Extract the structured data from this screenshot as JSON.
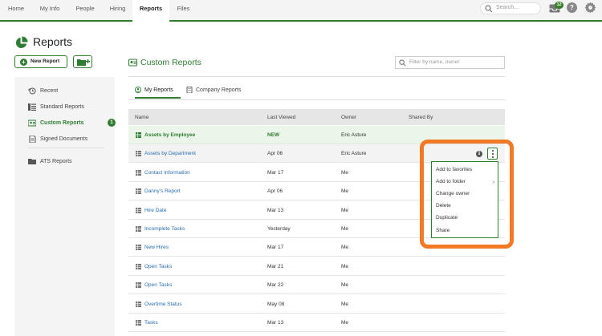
{
  "nav": {
    "tabs": [
      {
        "label": "Home"
      },
      {
        "label": "My Info"
      },
      {
        "label": "People"
      },
      {
        "label": "Hiring"
      },
      {
        "label": "Reports",
        "active": true
      },
      {
        "label": "Files"
      }
    ],
    "search_placeholder": "Search...",
    "inbox_count": "12",
    "help_label": "?"
  },
  "page": {
    "title": "Reports",
    "new_report_label": "New Report"
  },
  "sidebar": {
    "items": [
      {
        "label": "Recent",
        "icon": "clock-history-icon"
      },
      {
        "label": "Standard Reports",
        "icon": "report-list-icon"
      },
      {
        "label": "Custom Reports",
        "icon": "custom-report-icon",
        "active": true,
        "badge": "1"
      },
      {
        "label": "Signed Documents",
        "icon": "document-icon"
      },
      {
        "label": "ATS Reports",
        "icon": "folder-icon"
      }
    ]
  },
  "main": {
    "section_title": "Custom Reports",
    "filter_placeholder": "Filter by name, owner",
    "tabs": [
      {
        "label": "My Reports",
        "active": true
      },
      {
        "label": "Company Reports"
      }
    ],
    "columns": [
      "Name",
      "Last Viewed",
      "Owner",
      "Shared By"
    ],
    "rows": [
      {
        "name": "Assets by Employee",
        "viewed": "NEW",
        "owner": "Eric Asture",
        "shared": ""
      },
      {
        "name": "Assets by Department",
        "viewed": "Apr 06",
        "owner": "Eric Asture",
        "shared": ""
      },
      {
        "name": "Contact Information",
        "viewed": "Mar 17",
        "owner": "Me",
        "shared": ""
      },
      {
        "name": "Danny's Report",
        "viewed": "Apr 06",
        "owner": "Me",
        "shared": ""
      },
      {
        "name": "Hire Date",
        "viewed": "Mar 13",
        "owner": "Me",
        "shared": ""
      },
      {
        "name": "Incomplete Tasks",
        "viewed": "Yesterday",
        "owner": "Me",
        "shared": ""
      },
      {
        "name": "New Hires",
        "viewed": "Mar 17",
        "owner": "Me",
        "shared": ""
      },
      {
        "name": "Open Tasks",
        "viewed": "Mar 21",
        "owner": "Me",
        "shared": ""
      },
      {
        "name": "Open Tasks",
        "viewed": "Mar 22",
        "owner": "Me",
        "shared": ""
      },
      {
        "name": "Overtime Status",
        "viewed": "May 08",
        "owner": "Me",
        "shared": ""
      },
      {
        "name": "Tasks",
        "viewed": "Mar 13",
        "owner": "Me",
        "shared": ""
      }
    ]
  },
  "menu": {
    "items": [
      "Add to favorites",
      "Add to folder",
      "Change owner",
      "Delete",
      "Duplicate",
      "Share"
    ],
    "info_label": "i"
  },
  "colors": {
    "brand_green": "#2e7d32",
    "link_blue": "#2a6db0",
    "highlight_orange": "#f07a26"
  }
}
